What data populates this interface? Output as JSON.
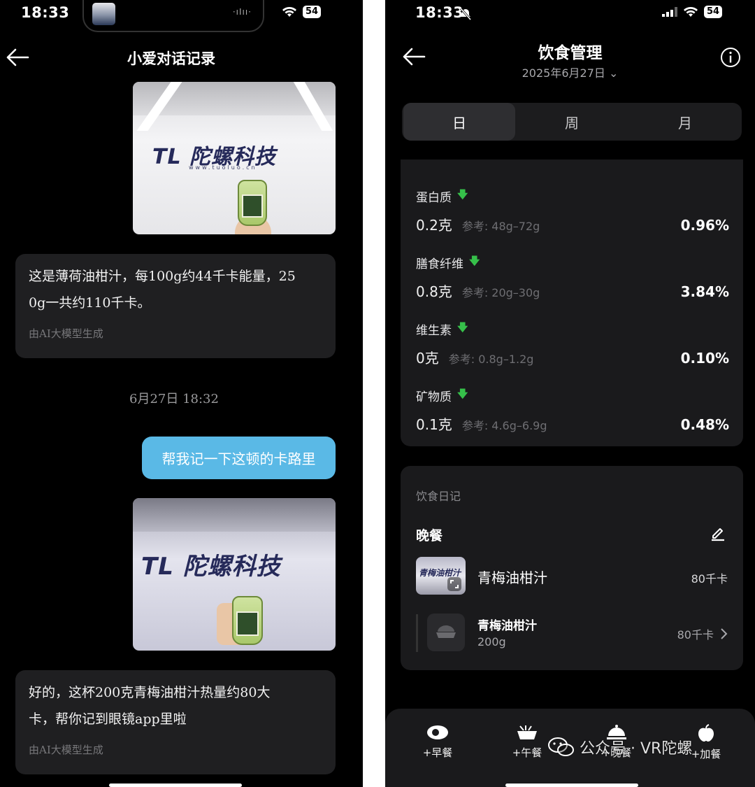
{
  "left": {
    "status": {
      "time": "18:33",
      "battery": "54"
    },
    "header": {
      "title": "小爱对话记录"
    },
    "messages": [
      {
        "text": "这是薄荷油柑汁，每100g约44千卡能量，250g一共约110千卡。",
        "line1": "这是薄荷油柑汁，每100g约44千卡能量，25",
        "line2": "0g一共约110千卡。",
        "footer": "由AI大模型生成"
      },
      {
        "timestamp": "6月27日 18:32"
      },
      {
        "text": "帮我记一下这顿的卡路里"
      },
      {
        "text": "好的，这杯200克青梅油柑汁热量约80大卡，帮你记到眼镜app里啦",
        "line1": "好的，这杯200克青梅油柑汁热量约80大",
        "line2": "卡，帮你记到眼镜app里啦",
        "footer": "由AI大模型生成"
      }
    ],
    "photo_logo": "陀螺科技",
    "photo_logo_mark": "TL"
  },
  "right": {
    "status": {
      "time": "18:33",
      "battery": "54"
    },
    "header": {
      "title": "饮食管理",
      "date": "2025年6月27日"
    },
    "tabs": [
      {
        "label": "日",
        "active": true
      },
      {
        "label": "周"
      },
      {
        "label": "月"
      }
    ],
    "nutrients": [
      {
        "name": "蛋白质",
        "value": "0.2克",
        "ref": "参考: 48g–72g",
        "pct": "0.96%"
      },
      {
        "name": "膳食纤维",
        "value": "0.8克",
        "ref": "参考: 20g–30g",
        "pct": "3.84%"
      },
      {
        "name": "维生素",
        "value": "0克",
        "ref": "参考: 0.8g–1.2g",
        "pct": "0.10%"
      },
      {
        "name": "矿物质",
        "value": "0.1克",
        "ref": "参考: 4.6g–6.9g",
        "pct": "0.48%"
      }
    ],
    "diary": {
      "title": "饮食日记",
      "meal": "晚餐",
      "item": {
        "name": "青梅油柑汁",
        "kcal": "80千卡"
      },
      "sub": {
        "name": "青梅油柑汁",
        "weight": "200g",
        "kcal": "80千卡"
      }
    },
    "bottom_bar": [
      {
        "label": "+早餐",
        "icon": "egg-icon"
      },
      {
        "label": "+午餐",
        "icon": "bowl-icon"
      },
      {
        "label": "+晚餐",
        "icon": "cloche-icon"
      },
      {
        "label": "+加餐",
        "icon": "apple-icon"
      }
    ],
    "watermark": "公众号 · VR陀螺"
  },
  "colors": {
    "accent_bubble": "#5ab9e6",
    "down_arrow": "#36c04a",
    "card": "#1a1a1c"
  }
}
